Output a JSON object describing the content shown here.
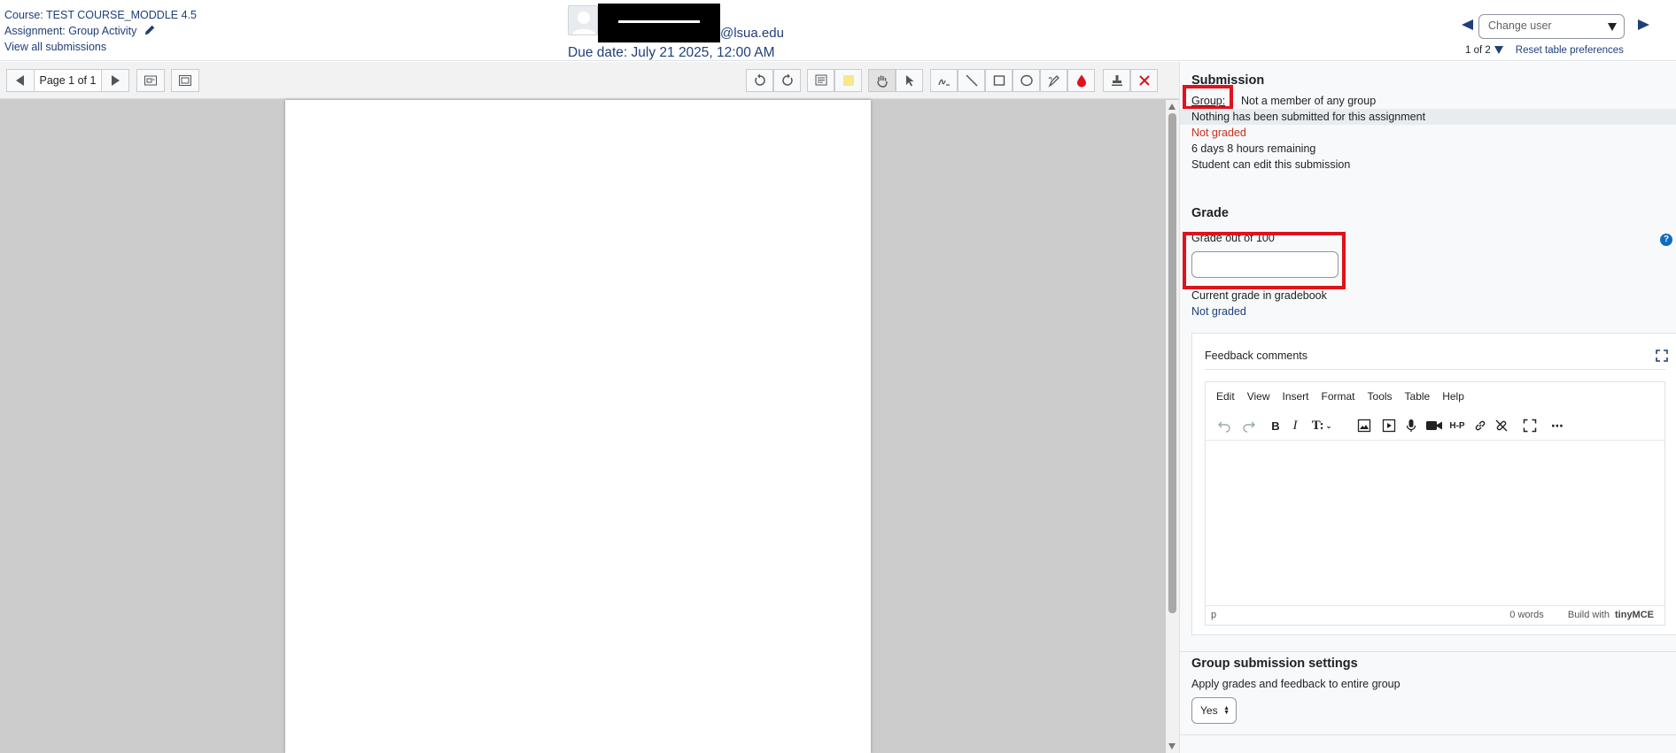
{
  "header": {
    "course": "Course: TEST COURSE_MODDLE 4.5",
    "assignment": "Assignment: Group Activity",
    "view_all": "View all submissions",
    "email_suffix": "@lsua.edu",
    "due_date": "Due date: July 21 2025, 12:00 AM",
    "change_user_placeholder": "Change user",
    "user_count": "1 of 2",
    "reset_prefs": "Reset table preferences"
  },
  "pdf": {
    "page_label": "Page 1 of 1"
  },
  "submission": {
    "title": "Submission",
    "group_label": "Group:",
    "group_value": "Not a member of any group",
    "status": "Nothing has been submitted for this assignment",
    "grading_status": "Not graded",
    "time_remaining": "6 days 8 hours remaining",
    "edit_status": "Student can edit this submission"
  },
  "grade": {
    "title": "Grade",
    "label": "Grade out of 100",
    "value": "",
    "current_label": "Current grade in gradebook",
    "current_value": "Not graded"
  },
  "feedback": {
    "title": "Feedback comments",
    "menu": [
      "Edit",
      "View",
      "Insert",
      "Format",
      "Tools",
      "Table",
      "Help"
    ],
    "status_path": "p",
    "word_count": "0 words",
    "build_with": "Build with",
    "brand": "tinyMCE"
  },
  "group_settings": {
    "title": "Group submission settings",
    "apply_label": "Apply grades and feedback to entire group",
    "apply_value": "Yes"
  },
  "colors": {
    "link": "#1f3f7a",
    "highlight": "#e0121b",
    "not_graded_red": "#ca3120"
  }
}
